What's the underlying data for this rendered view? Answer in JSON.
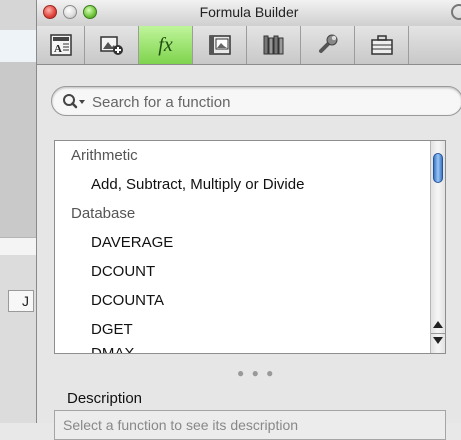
{
  "window": {
    "title": "Formula Builder"
  },
  "background": {
    "column_label": "J"
  },
  "toolbar": {
    "tools": [
      {
        "name": "text-box-icon"
      },
      {
        "name": "media-icon"
      },
      {
        "name": "fx-icon",
        "label": "fx",
        "active": true
      },
      {
        "name": "photo-album-icon"
      },
      {
        "name": "library-icon"
      },
      {
        "name": "wrench-icon"
      },
      {
        "name": "suitcase-icon"
      }
    ],
    "accent_color": "#8fdc5d"
  },
  "search": {
    "placeholder": "Search for a function"
  },
  "function_list": {
    "items": [
      {
        "text": "Arithmetic",
        "header": true
      },
      {
        "text": "Add, Subtract, Multiply or Divide",
        "header": false
      },
      {
        "text": "Database",
        "header": true
      },
      {
        "text": "DAVERAGE",
        "header": false
      },
      {
        "text": "DCOUNT",
        "header": false
      },
      {
        "text": "DCOUNTA",
        "header": false
      },
      {
        "text": "DGET",
        "header": false
      },
      {
        "text": "DMAX",
        "header": false
      }
    ]
  },
  "description": {
    "label": "Description",
    "text": "Select a function to see its description"
  }
}
